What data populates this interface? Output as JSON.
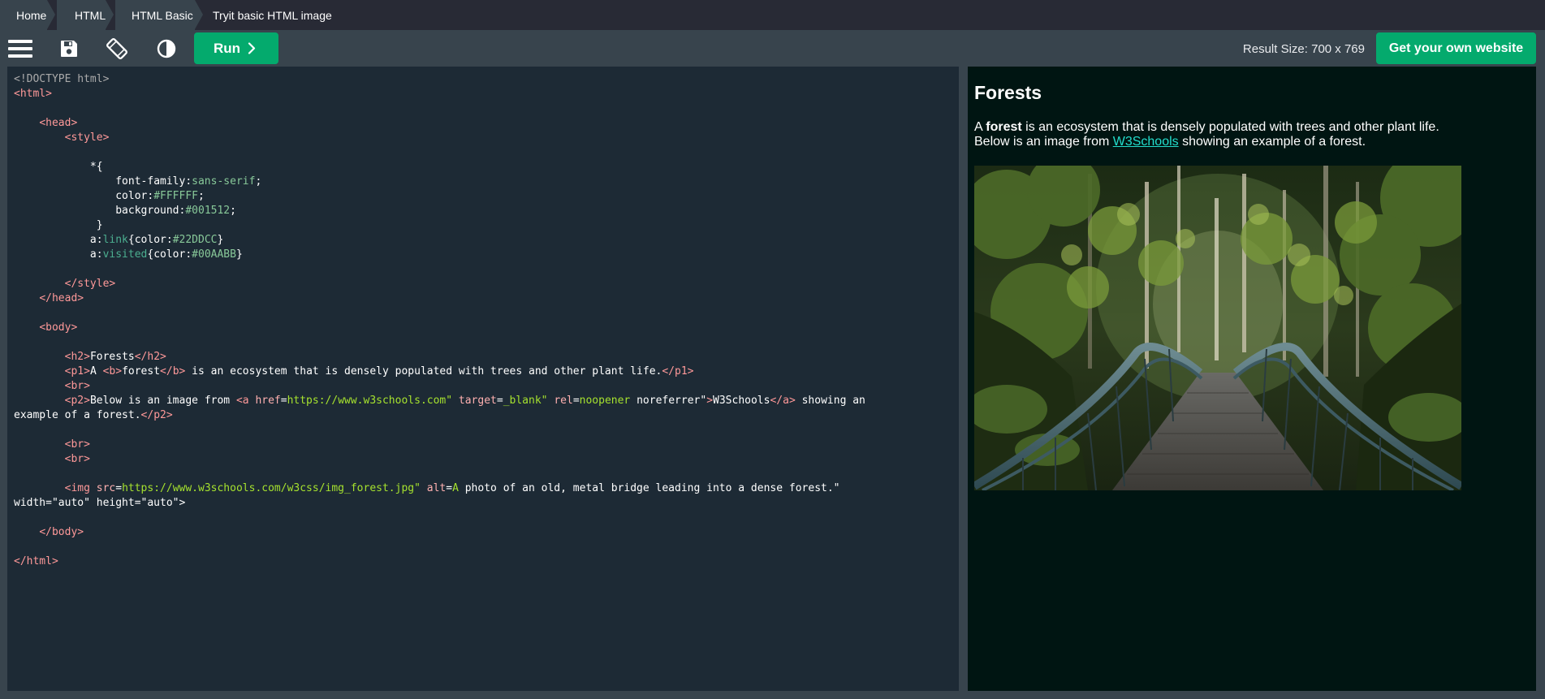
{
  "breadcrumb": {
    "items": [
      "Home",
      "HTML",
      "HTML Basic"
    ],
    "current": "Tryit basic HTML image"
  },
  "toolbar": {
    "icons": [
      "menu-icon",
      "save-icon",
      "rotate-icon",
      "contrast-icon"
    ],
    "run_label": "Run",
    "result_size": "Result Size: 700 x 769",
    "get_website_label": "Get your own website"
  },
  "colors": {
    "accent": "#04aa6d",
    "editor_bg": "#1d2a35",
    "result_bg": "#001512",
    "link": "#22DDCC",
    "visited": "#00AABB"
  },
  "editor": {
    "lines": [
      "<!DOCTYPE html>",
      "<html>",
      "",
      "    <head>",
      "        <style>",
      "",
      "            *{",
      "                font-family:sans-serif;",
      "                color:#FFFFFF;",
      "                background:#001512;",
      "             }",
      "            a:link{color:#22DDCC}",
      "            a:visited{color:#00AABB}",
      "",
      "        </style>",
      "    </head>",
      "",
      "    <body>",
      "",
      "        <h2>Forests</h2>",
      "        <p1>A <b>forest</b> is an ecosystem that is densely populated with trees and other plant life.</p1>",
      "        <br>",
      "        <p2>Below is an image from <a href=\"https://www.w3schools.com\" target=\"_blank\" rel=\"noopener noreferrer\">W3Schools</a> showing an",
      "example of a forest.</p2>",
      "",
      "        <br>",
      "        <br>",
      "",
      "        <img src=\"https://www.w3schools.com/w3css/img_forest.jpg\" alt=\"A photo of an old, metal bridge leading into a dense forest.\"",
      "width=\"auto\" height=\"auto\">",
      "",
      "    </body>",
      "",
      "</html>"
    ]
  },
  "result": {
    "heading": "Forests",
    "p1_prefix": "A ",
    "p1_bold": "forest",
    "p1_suffix": " is an ecosystem that is densely populated with trees and other plant life.",
    "p2_prefix": "Below is an image from ",
    "p2_link": "W3Schools",
    "p2_suffix": " showing an example of a forest.",
    "image_alt": "A photo of an old, metal bridge leading into a dense forest."
  }
}
